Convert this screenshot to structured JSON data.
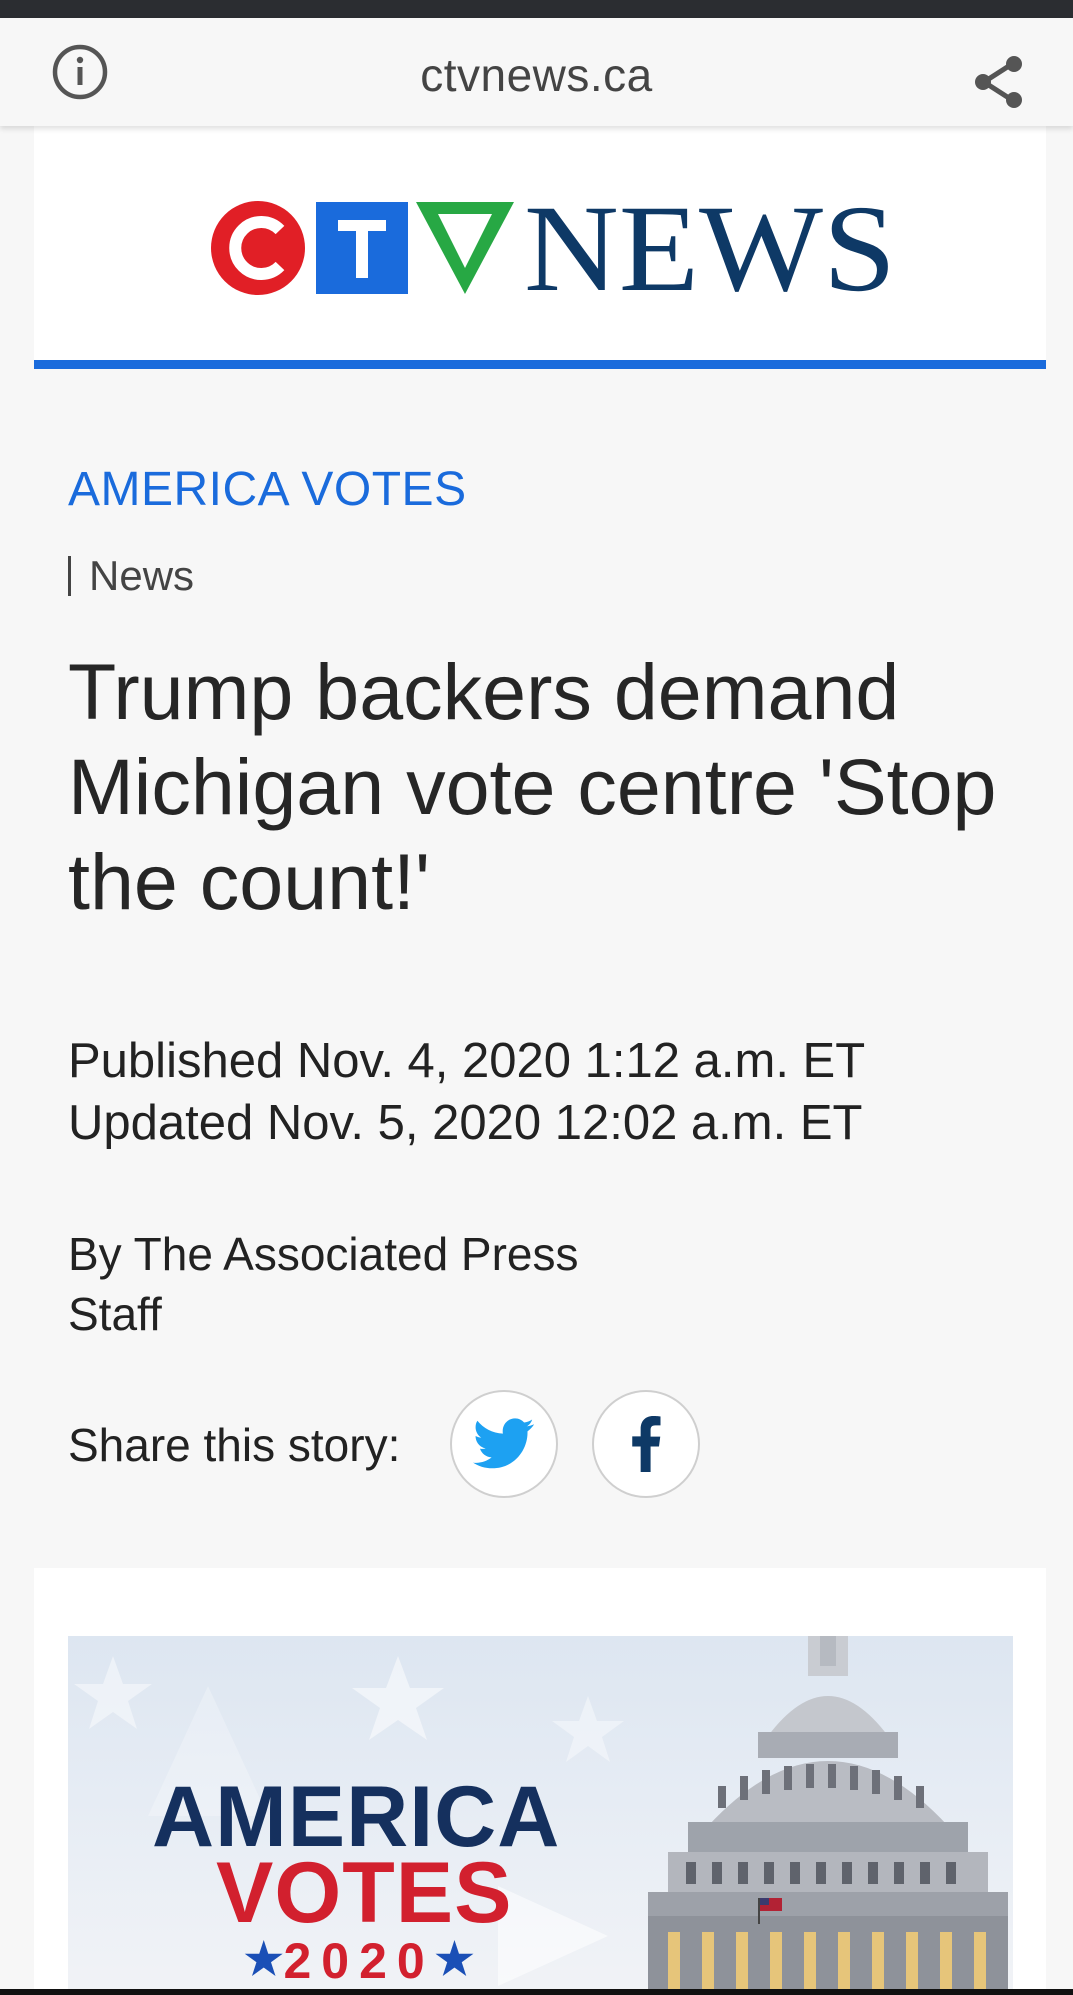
{
  "browser": {
    "url": "ctvnews.ca",
    "info_icon": "info-icon",
    "share_icon": "share-icon"
  },
  "logo": {
    "text": "CTV NEWS",
    "colors": {
      "red": "#e11f26",
      "blue": "#1a6bdc",
      "green": "#27a844",
      "navy": "#0e3966"
    }
  },
  "article": {
    "section": "AMERICA VOTES",
    "category": "News",
    "headline": "Trump backers demand Michigan vote centre 'Stop the count!'",
    "published": "Published Nov. 4, 2020 1:12 a.m. ET",
    "updated": "Updated Nov. 5, 2020 12:02 a.m. ET",
    "byline_line1": "By The Associated Press",
    "byline_line2": "Staff",
    "share_label": "Share this story:"
  },
  "hero_image": {
    "line1": "AMERICA",
    "line2": "VOTES",
    "year": "2020"
  },
  "colors": {
    "accent": "#1a6bdc",
    "twitter": "#1da1f2",
    "facebook": "#0e3966"
  }
}
